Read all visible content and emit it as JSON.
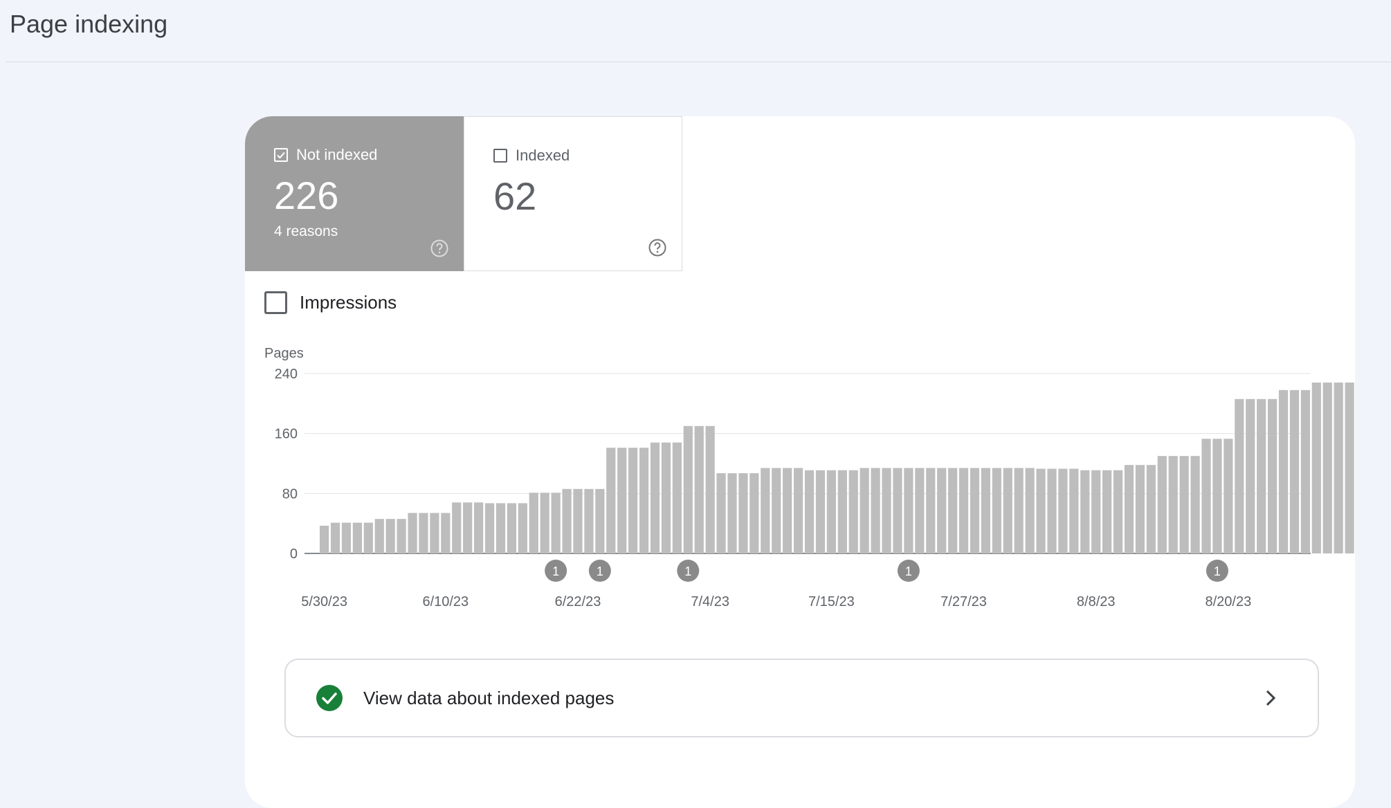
{
  "page": {
    "title": "Page indexing"
  },
  "summary": {
    "not_indexed": {
      "label": "Not indexed",
      "count": "226",
      "sub": "4 reasons",
      "checked": true
    },
    "indexed": {
      "label": "Indexed",
      "count": "62",
      "checked": false
    }
  },
  "impressions": {
    "label": "Impressions",
    "checked": false
  },
  "chart_data": {
    "type": "bar",
    "ylabel": "Pages",
    "ylim": [
      0,
      240
    ],
    "y_ticks": [
      "240",
      "160",
      "80",
      "0"
    ],
    "x_tick_labels": [
      "5/30/23",
      "6/10/23",
      "6/22/23",
      "7/4/23",
      "7/15/23",
      "7/27/23",
      "8/8/23",
      "8/20/23"
    ],
    "x_tick_indices": [
      0,
      11,
      23,
      35,
      46,
      58,
      70,
      82
    ],
    "values": [
      37,
      41,
      41,
      41,
      41,
      46,
      46,
      46,
      54,
      54,
      54,
      54,
      68,
      68,
      68,
      67,
      67,
      67,
      67,
      81,
      81,
      81,
      86,
      86,
      86,
      86,
      141,
      141,
      141,
      141,
      148,
      148,
      148,
      170,
      170,
      170,
      107,
      107,
      107,
      107,
      114,
      114,
      114,
      114,
      111,
      111,
      111,
      111,
      111,
      114,
      114,
      114,
      114,
      114,
      114,
      114,
      114,
      114,
      114,
      114,
      114,
      114,
      114,
      114,
      114,
      113,
      113,
      113,
      113,
      111,
      111,
      111,
      111,
      118,
      118,
      118,
      130,
      130,
      130,
      130,
      153,
      153,
      153,
      206,
      206,
      206,
      206,
      218,
      218,
      218,
      228,
      228,
      228,
      228
    ],
    "annotations": [
      {
        "index": 21,
        "label": "1"
      },
      {
        "index": 25,
        "label": "1"
      },
      {
        "index": 33,
        "label": "1"
      },
      {
        "index": 53,
        "label": "1"
      },
      {
        "index": 81,
        "label": "1"
      }
    ],
    "bar_color": "#bdbdbd"
  },
  "footer_link": {
    "label": "View data about indexed pages"
  },
  "colors": {
    "active_tile": "#9e9e9e",
    "success": "#188038",
    "background": "#f1f4fb"
  }
}
